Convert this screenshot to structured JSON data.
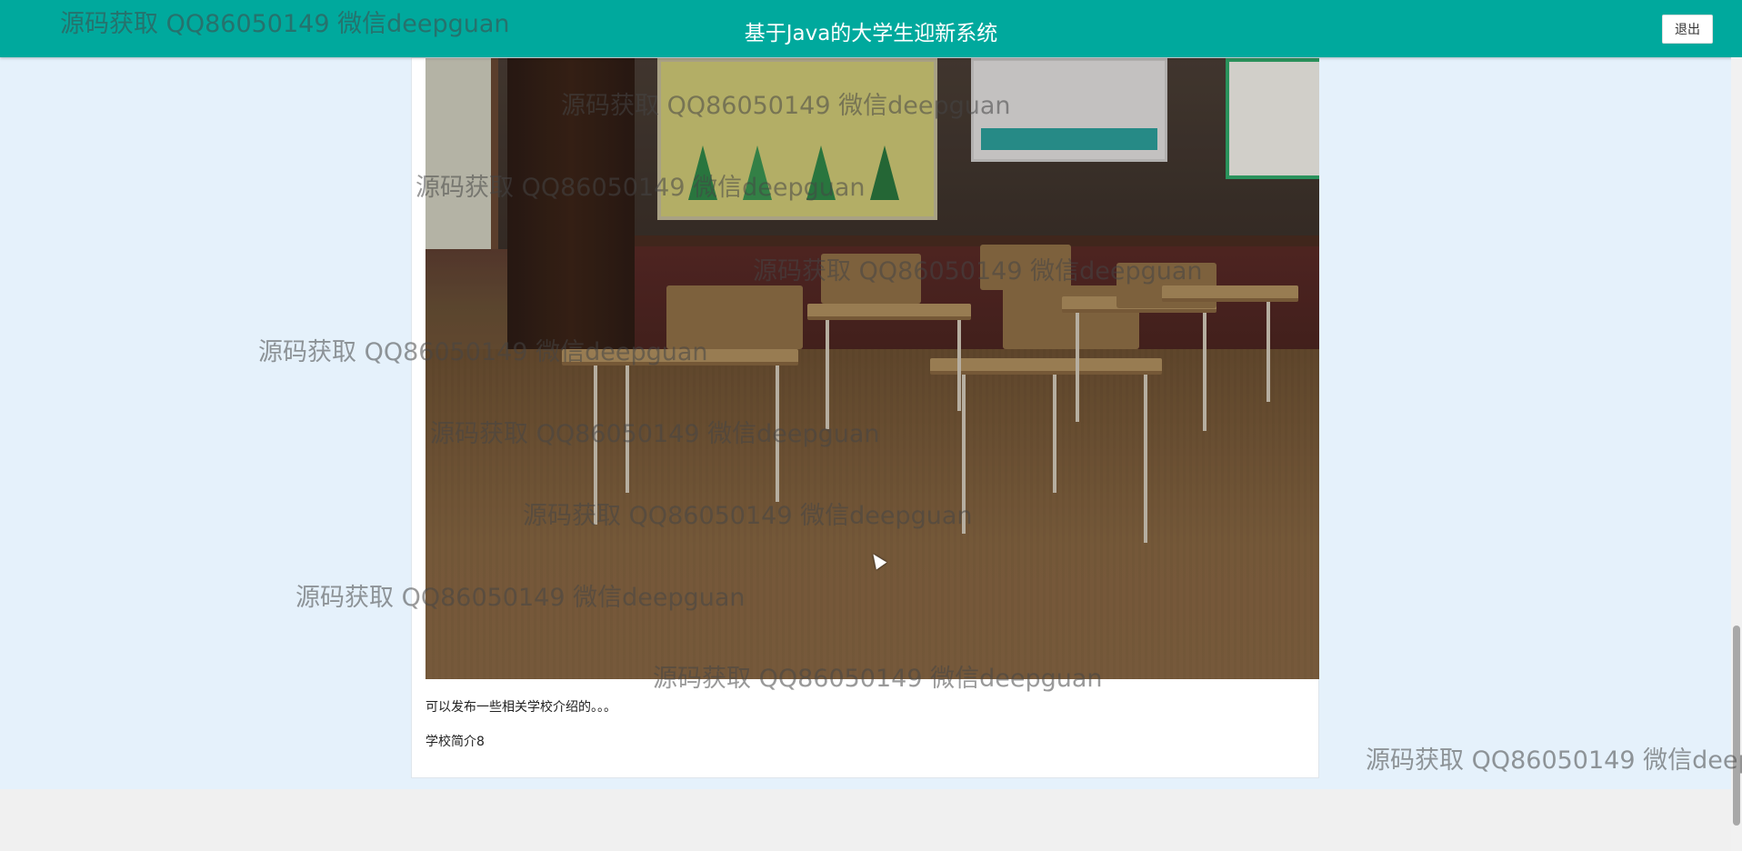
{
  "header": {
    "title": "基于Java的大学生迎新系统",
    "logout_label": "退出"
  },
  "article": {
    "image_alt": "classroom",
    "paragraphs": [
      "可以发布一些相关学校介绍的。。。",
      "学校简介8"
    ]
  },
  "watermark": {
    "text": "源码获取 QQ86050149 微信deepguan"
  },
  "colors": {
    "header_bg": "#00a99d",
    "page_bg": "#e5f1fb"
  }
}
